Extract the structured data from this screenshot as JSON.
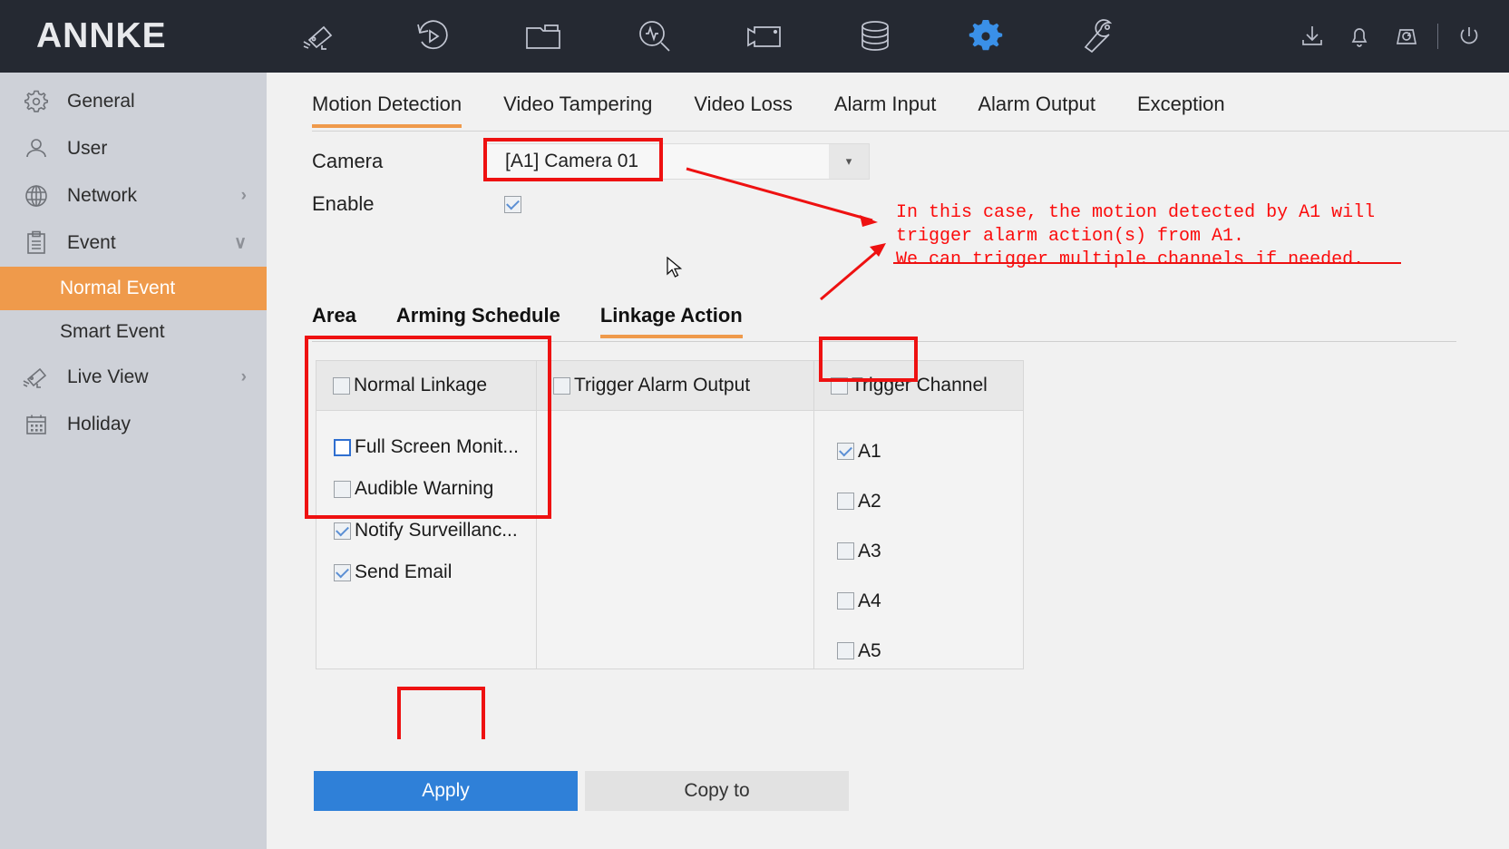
{
  "brand": {
    "name": "ANNKE"
  },
  "topbar": {
    "nav_icons": [
      {
        "name": "camera-icon",
        "label": "Camera"
      },
      {
        "name": "playback-icon",
        "label": "Playback"
      },
      {
        "name": "folder-icon",
        "label": "File Management"
      },
      {
        "name": "search-analytics-icon",
        "label": "Smart Search"
      },
      {
        "name": "video-record-icon",
        "label": "Recording"
      },
      {
        "name": "storage-icon",
        "label": "Storage"
      },
      {
        "name": "gear-icon",
        "label": "Configuration"
      },
      {
        "name": "wrench-icon",
        "label": "Maintenance"
      }
    ],
    "right_icons": [
      {
        "name": "download-icon",
        "label": "Download"
      },
      {
        "name": "bell-icon",
        "label": "Alarm"
      },
      {
        "name": "refresh-box-icon",
        "label": "Update"
      },
      {
        "name": "power-icon",
        "label": "Power"
      }
    ],
    "active_nav_index": 6
  },
  "sidebar": {
    "items": [
      {
        "label": "General",
        "icon": "gear-icon",
        "chevron": "",
        "selected": false
      },
      {
        "label": "User",
        "icon": "user-icon",
        "chevron": "",
        "selected": false
      },
      {
        "label": "Network",
        "icon": "globe-icon",
        "chevron": "›",
        "selected": false
      },
      {
        "label": "Event",
        "icon": "clipboard-icon",
        "chevron": "∨",
        "selected": false
      }
    ],
    "sub_items": [
      {
        "label": "Normal Event",
        "selected": true
      },
      {
        "label": "Smart Event",
        "selected": false
      }
    ],
    "items_after": [
      {
        "label": "Live View",
        "icon": "camera-icon",
        "chevron": "›",
        "selected": false
      },
      {
        "label": "Holiday",
        "icon": "calendar-icon",
        "chevron": "",
        "selected": false
      }
    ]
  },
  "main": {
    "tabs": [
      {
        "label": "Motion Detection",
        "active": true
      },
      {
        "label": "Video Tampering",
        "active": false
      },
      {
        "label": "Video Loss",
        "active": false
      },
      {
        "label": "Alarm Input",
        "active": false
      },
      {
        "label": "Alarm Output",
        "active": false
      },
      {
        "label": "Exception",
        "active": false
      }
    ],
    "camera": {
      "label": "Camera",
      "value": "[A1] Camera 01",
      "arrow": "▾"
    },
    "enable": {
      "label": "Enable",
      "checked": true
    },
    "sub_tabs": [
      {
        "label": "Area",
        "active": false
      },
      {
        "label": "Arming Schedule",
        "active": false
      },
      {
        "label": "Linkage Action",
        "active": true
      }
    ],
    "linkage": {
      "columns": [
        {
          "header": "Normal Linkage",
          "header_checked": false,
          "items": [
            {
              "label": "Full Screen Monit...",
              "checked": false,
              "focused": true
            },
            {
              "label": "Audible Warning",
              "checked": false,
              "focused": false
            },
            {
              "label": "Notify Surveillanc...",
              "checked": true,
              "focused": false
            },
            {
              "label": "Send Email",
              "checked": true,
              "focused": false
            }
          ]
        },
        {
          "header": "Trigger Alarm Output",
          "header_checked": false,
          "items": []
        },
        {
          "header": "Trigger Channel",
          "header_checked": false,
          "items": [
            {
              "label": "A1",
              "checked": true,
              "focused": false
            },
            {
              "label": "A2",
              "checked": false,
              "focused": false
            },
            {
              "label": "A3",
              "checked": false,
              "focused": false
            },
            {
              "label": "A4",
              "checked": false,
              "focused": false
            },
            {
              "label": "A5",
              "checked": false,
              "focused": false
            }
          ]
        }
      ]
    },
    "buttons": {
      "apply": "Apply",
      "copy_to": "Copy to"
    }
  },
  "annotation": {
    "line1": "In this case, the motion detected by A1 will",
    "line2": "trigger alarm action(s) from A1.",
    "line3": "We can trigger multiple channels if needed.",
    "color": "#fb0b0b",
    "highlight_color": "#ee1111"
  }
}
